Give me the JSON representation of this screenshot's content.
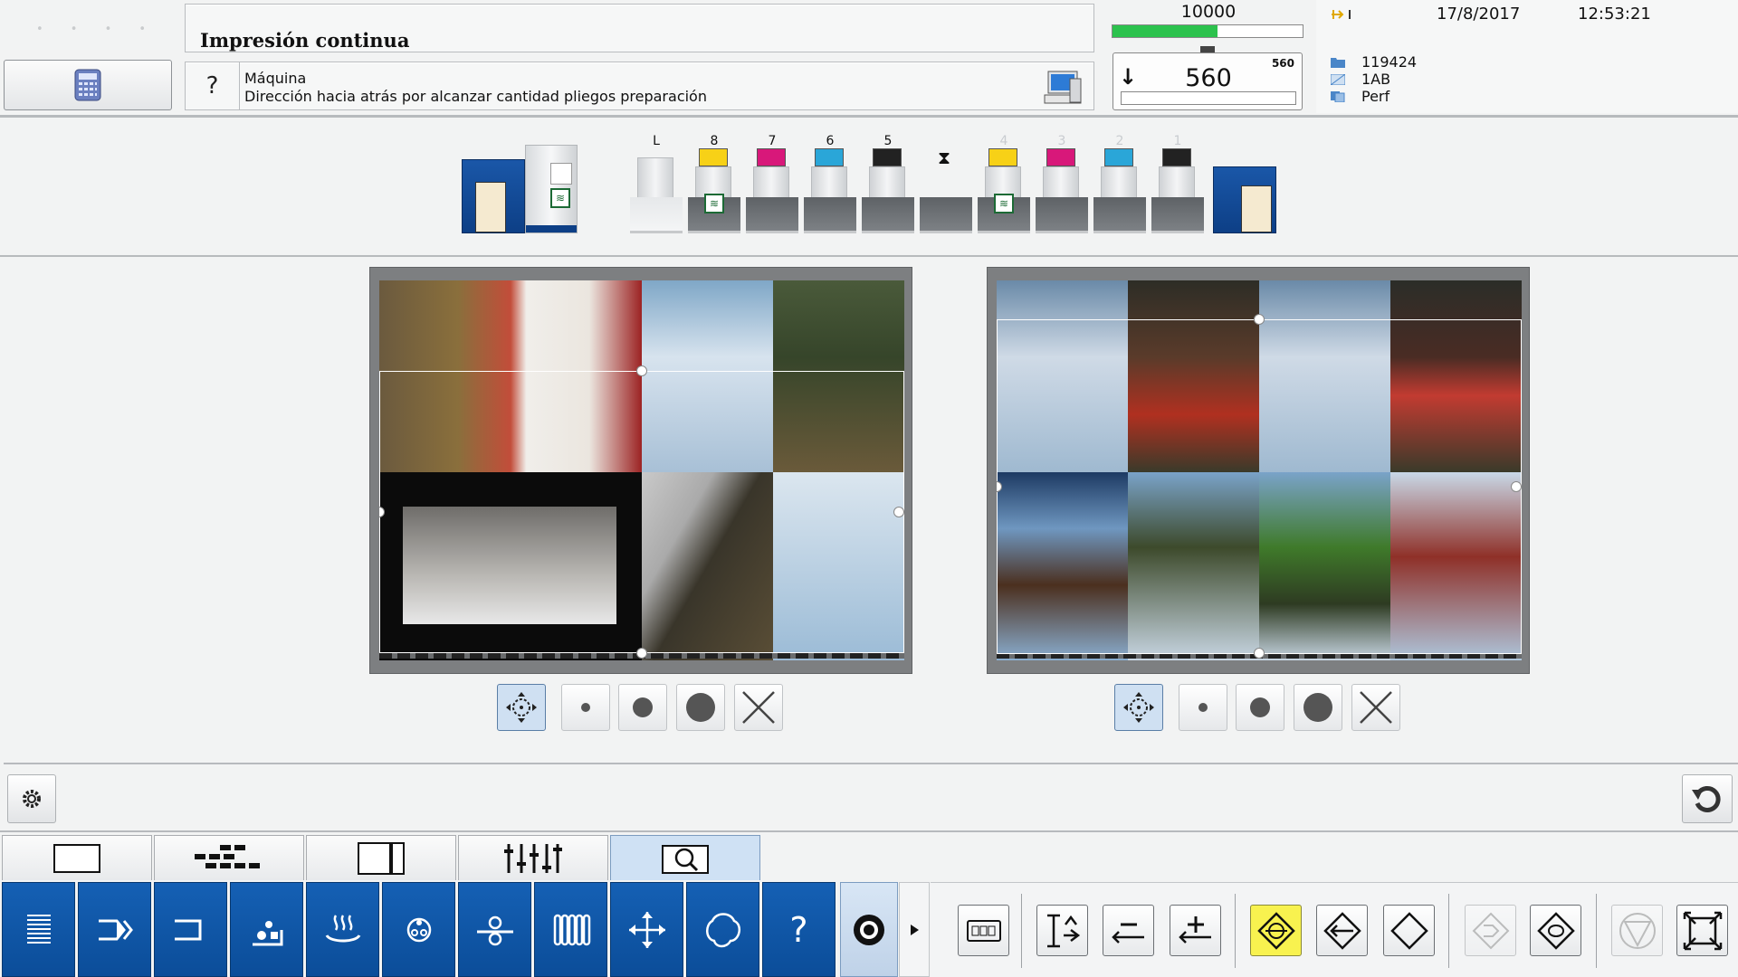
{
  "header": {
    "title": "Impresión continua",
    "message_category": "Máquina",
    "message_text": "Dirección hacia atrás por alcanzar cantidad pliegos preparación",
    "help_symbol": "?"
  },
  "counter": {
    "target": "10000",
    "progress_fraction": 0.55,
    "current": "560",
    "current_small": "560",
    "arrow": "↓"
  },
  "info": {
    "date": "17/8/2017",
    "time": "12:53:21",
    "job_number": "119424",
    "job_code": "1AB",
    "job_name": "Perf"
  },
  "press": {
    "coater_label": "L",
    "units": [
      {
        "label": "8",
        "color": "#f7d117"
      },
      {
        "label": "7",
        "color": "#d8187a"
      },
      {
        "label": "6",
        "color": "#2aa6d8"
      },
      {
        "label": "5",
        "color": "#222222"
      },
      {
        "label": "4",
        "color": "#f7d117"
      },
      {
        "label": "3",
        "color": "#d8187a"
      },
      {
        "label": "2",
        "color": "#2aa6d8"
      },
      {
        "label": "1",
        "color": "#222222"
      }
    ]
  },
  "colors": {
    "accent_blue": "#0b4d99",
    "progress_green": "#2cc24d",
    "highlight_yellow": "#f8f24f"
  },
  "icons": {
    "tabs": [
      "sheet-icon",
      "ink-zones-icon",
      "sheet-edge-icon",
      "register-icon",
      "inspect-icon"
    ],
    "nav": [
      "list-icon",
      "feed-icon",
      "delivery-icon",
      "plate-icon",
      "dryer-icon",
      "dampening-icon",
      "roller-icon",
      "ink-fountain-icon",
      "move-icon",
      "wash-icon",
      "help-icon"
    ],
    "right_toolbar": [
      "ink-keys-icon",
      "register-up-icon",
      "minus-icon",
      "plus-icon",
      "center-target-icon",
      "left-diamond-icon",
      "diamond-icon",
      "forward-dim-icon",
      "sheet-rotate-icon",
      "stop-dim-icon",
      "fit-icon"
    ]
  }
}
